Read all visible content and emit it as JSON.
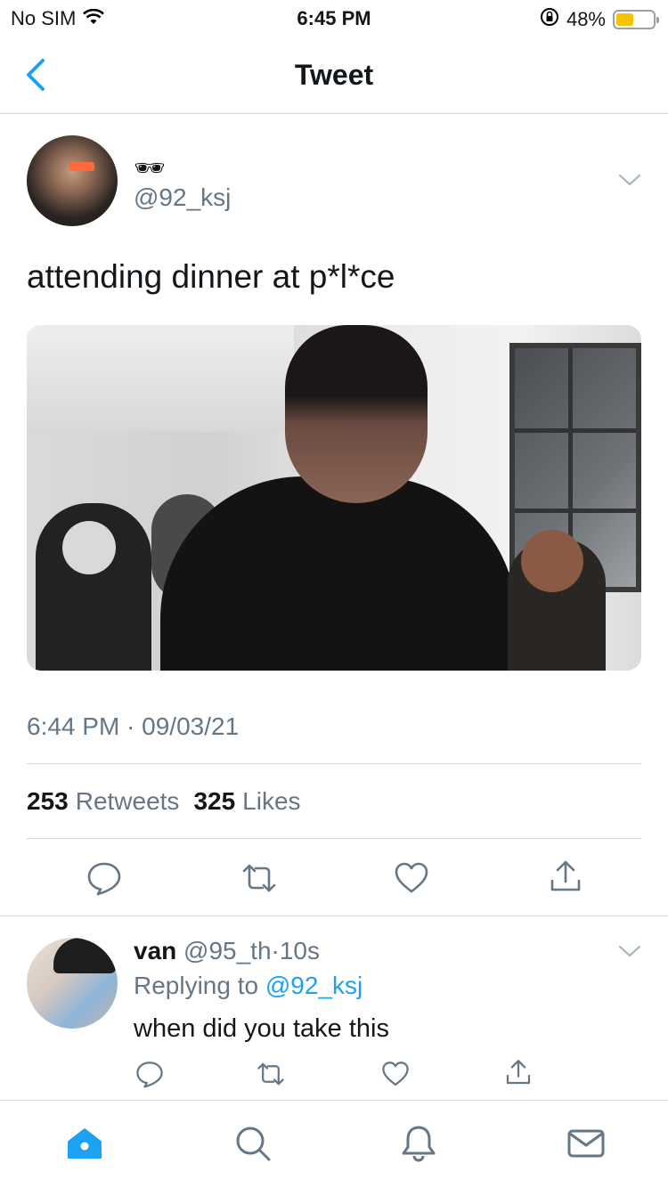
{
  "status_bar": {
    "carrier": "No SIM",
    "time": "6:45 PM",
    "battery_percent": "48%",
    "battery_level": 0.48,
    "battery_color": "#f5c400"
  },
  "nav": {
    "title": "Tweet",
    "back_icon": "chevron-left-icon",
    "accent": "#1da1f2"
  },
  "tweet": {
    "display_name": "🕶",
    "handle": "@92_ksj",
    "text": "attending dinner at p*l*ce",
    "timestamp": "6:44 PM · 09/03/21",
    "retweets_count": "253",
    "retweets_label": "Retweets",
    "likes_count": "325",
    "likes_label": "Likes",
    "actions": [
      "reply-icon",
      "retweet-icon",
      "like-icon",
      "share-icon"
    ]
  },
  "reply": {
    "name": "van",
    "handle": "@95_th",
    "separator": "·",
    "time": "10s",
    "replying_prefix": "Replying to",
    "replying_to": "@92_ksj",
    "text": "when did you take this",
    "actions": [
      "reply-icon",
      "retweet-icon",
      "like-icon",
      "share-icon"
    ]
  },
  "tab_bar": {
    "items": [
      "home-icon",
      "search-icon",
      "notifications-icon",
      "messages-icon"
    ],
    "active": "home-icon",
    "active_color": "#1da1f2"
  }
}
